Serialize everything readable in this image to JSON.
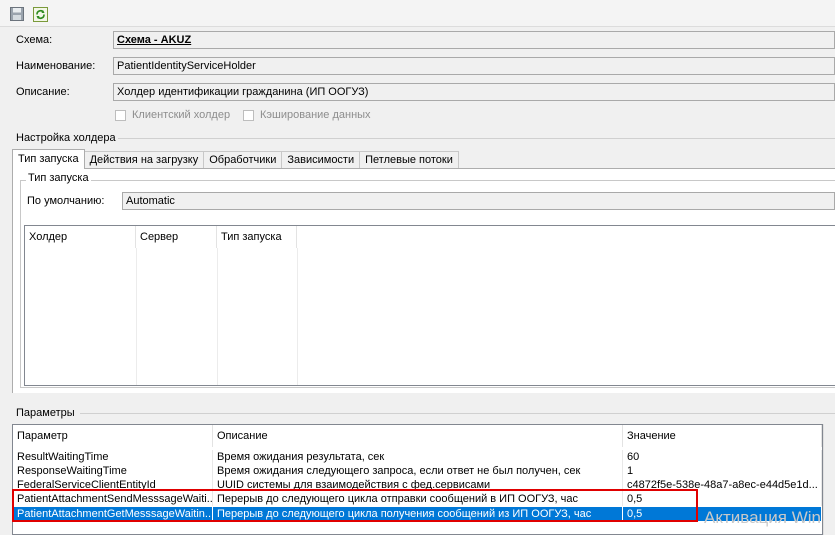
{
  "toolbar": {
    "save_icon": "save-icon",
    "refresh_icon": "refresh-icon"
  },
  "form": {
    "schema_label": "Схема:",
    "schema_value": "Схема - AKUZ",
    "name_label": "Наименование:",
    "name_value": "PatientIdentityServiceHolder",
    "description_label": "Описание:",
    "description_value": "Холдер идентификации гражданина (ИП ООГУЗ)",
    "client_holder_label": "Клиентский холдер",
    "caching_label": "Кэширование данных"
  },
  "holder_settings": {
    "title": "Настройка холдера",
    "tabs": [
      "Тип запуска",
      "Действия на загрузку",
      "Обработчики",
      "Зависимости",
      "Петлевые потоки"
    ],
    "group_title": "Тип запуска",
    "default_label": "По умолчанию:",
    "default_value": "Automatic",
    "grid_headers": [
      "Холдер",
      "Сервер",
      "Тип запуска"
    ]
  },
  "params": {
    "title": "Параметры",
    "headers": [
      "Параметр",
      "Описание",
      "Значение"
    ],
    "rows": [
      {
        "name": "ResultWaitingTime",
        "desc": "Время ожидания результата, сек",
        "value": "60"
      },
      {
        "name": "ResponseWaitingTime",
        "desc": "Время ожидания следующего запроса, если ответ не был получен, сек",
        "value": "1"
      },
      {
        "name": "FederalServiceClientEntityId",
        "desc": "UUID системы для взаимодействия с фед.сервисами",
        "value": "c4872f5e-538e-48a7-a8ec-e44d5e1d..."
      },
      {
        "name": "PatientAttachmentSendMesssageWaiti...",
        "desc": "Перерыв до следующего цикла отправки сообщений в ИП ООГУЗ, час",
        "value": "0,5"
      },
      {
        "name": "PatientAttachmentGetMesssageWaitin...",
        "desc": "Перерыв до следующего цикла получения сообщений из ИП ООГУЗ, час",
        "value": "0,5"
      }
    ],
    "selected_row": 4
  },
  "watermark": {
    "line1": "Активация Win"
  },
  "colors": {
    "selection": "#0078d7",
    "highlight_box": "#e00000"
  }
}
